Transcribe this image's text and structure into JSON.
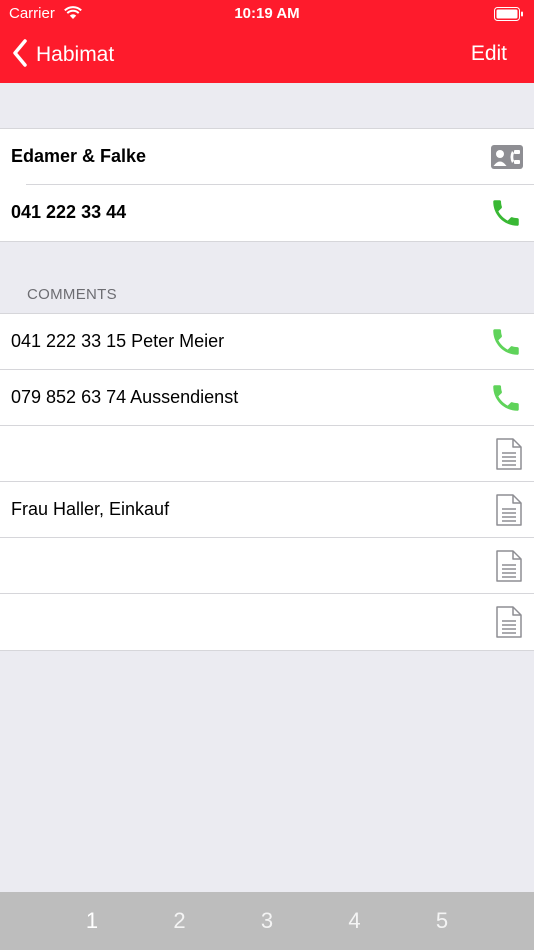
{
  "status_bar": {
    "carrier": "Carrier",
    "time": "10:19 AM"
  },
  "nav": {
    "back_label": "Habimat",
    "edit_label": "Edit"
  },
  "info": {
    "company": "Edamer & Falke",
    "phone": "041 222 33 44"
  },
  "comments": {
    "header": "COMMENTS",
    "rows": [
      {
        "text": "041 222 33 15 Peter Meier",
        "icon": "phone-icon"
      },
      {
        "text": "079 852 63 74 Aussendienst",
        "icon": "phone-icon"
      },
      {
        "text": "",
        "icon": "document-icon"
      },
      {
        "text": "Frau Haller, Einkauf",
        "icon": "document-icon"
      },
      {
        "text": "",
        "icon": "document-icon"
      },
      {
        "text": "",
        "icon": "document-icon"
      }
    ]
  },
  "tabs": [
    "1",
    "2",
    "3",
    "4",
    "5"
  ],
  "colors": {
    "accent": "#fe1b2c",
    "phone_green": "#4cd964",
    "icon_gray": "#8e8e93",
    "tab_bar": "#bdbdbd"
  }
}
